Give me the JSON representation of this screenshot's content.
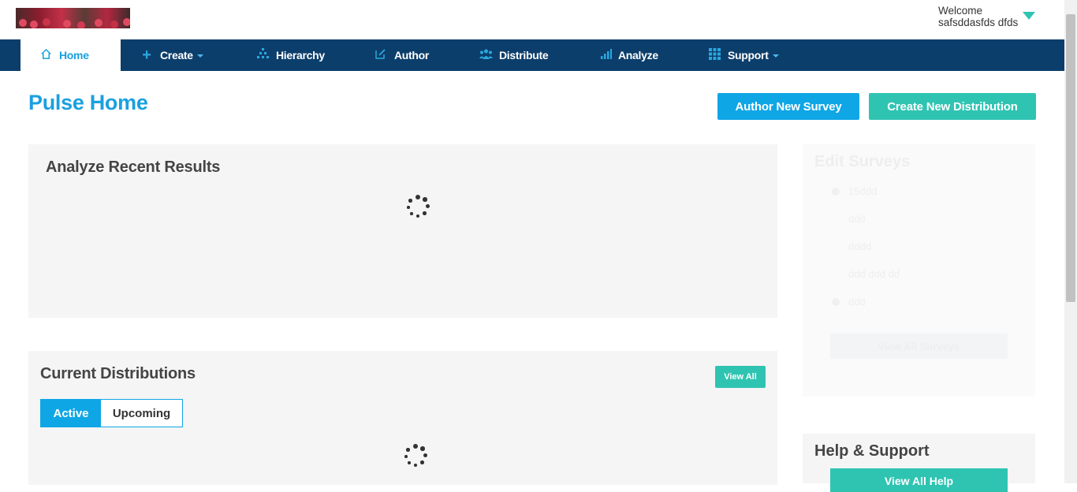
{
  "header": {
    "welcome_label": "Welcome",
    "user_name": "safsddasfds dfds"
  },
  "nav": {
    "home": {
      "label": "Home",
      "icon": "home-icon"
    },
    "create": {
      "label": "Create",
      "icon": "plus-icon"
    },
    "hierarchy": {
      "label": "Hierarchy",
      "icon": "hierarchy-icon"
    },
    "author": {
      "label": "Author",
      "icon": "edit-icon"
    },
    "distribute": {
      "label": "Distribute",
      "icon": "people-icon"
    },
    "analyze": {
      "label": "Analyze",
      "icon": "bar-chart-icon"
    },
    "support": {
      "label": "Support",
      "icon": "grid-icon"
    }
  },
  "page": {
    "title": "Pulse Home",
    "author_button": "Author New Survey",
    "distribution_button": "Create New Distribution"
  },
  "analyze_panel": {
    "title": "Analyze Recent Results"
  },
  "current_distributions": {
    "title": "Current Distributions",
    "view_all": "View All",
    "tabs": {
      "active": "Active",
      "upcoming": "Upcoming"
    }
  },
  "edit_surveys": {
    "title": "Edit Surveys",
    "items": [
      "15ddd",
      "ddd",
      "dddd",
      "ddd ddd dd",
      "ddd"
    ],
    "button": "View All Surveys"
  },
  "help": {
    "title": "Help & Support",
    "button": "View All Help"
  },
  "colors": {
    "nav_bg": "#0c3e6b",
    "accent_blue": "#1aa0e0",
    "accent_teal": "#2fc4b2"
  }
}
